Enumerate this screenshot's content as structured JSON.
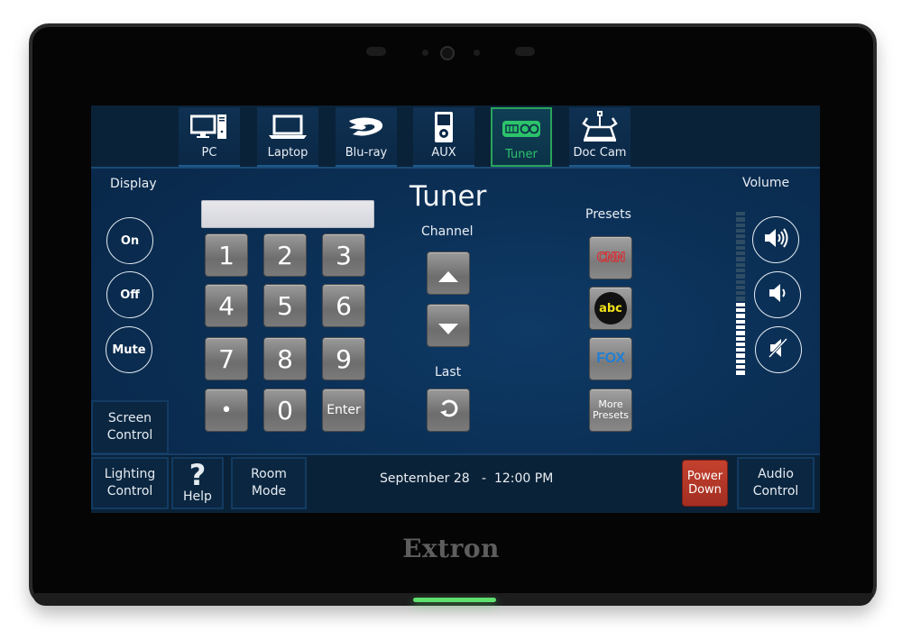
{
  "device": {
    "brand": "Extron"
  },
  "sources": [
    {
      "label": "PC",
      "icon": "pc-icon",
      "active": false
    },
    {
      "label": "Laptop",
      "icon": "laptop-icon",
      "active": false
    },
    {
      "label": "Blu-ray",
      "icon": "bluray-icon",
      "active": false
    },
    {
      "label": "AUX",
      "icon": "aux-player-icon",
      "active": false
    },
    {
      "label": "Tuner",
      "icon": "tuner-icon",
      "active": true
    },
    {
      "label": "Doc Cam",
      "icon": "document-camera-icon",
      "active": false
    }
  ],
  "display": {
    "label": "Display",
    "buttons": [
      "On",
      "Off",
      "Mute"
    ],
    "screen_control": [
      "Screen",
      "Control"
    ]
  },
  "keypad": {
    "entry_value": "",
    "keys": [
      "1",
      "2",
      "3",
      "4",
      "5",
      "6",
      "7",
      "8",
      "9",
      "•",
      "0",
      "Enter"
    ]
  },
  "tuner": {
    "title": "Tuner",
    "channel_label": "Channel",
    "last_label": "Last"
  },
  "presets": {
    "label": "Presets",
    "items": [
      {
        "name": "CNN",
        "icon": "cnn-logo"
      },
      {
        "name": "abc",
        "icon": "abc-logo"
      },
      {
        "name": "FOX",
        "icon": "fox-logo"
      },
      {
        "name": "More Presets",
        "lines": [
          "More",
          "Presets"
        ]
      }
    ]
  },
  "volume": {
    "label": "Volume",
    "level_percent": 45,
    "segments_total": 29,
    "segments_lit": 13,
    "buttons": [
      "volume-up",
      "volume-down",
      "volume-mute"
    ]
  },
  "bottom_bar": {
    "lighting_control": [
      "Lighting",
      "Control"
    ],
    "help": "Help",
    "room_mode": [
      "Room",
      "Mode"
    ],
    "date": "September 28",
    "time": "12:00 PM",
    "power_down": [
      "Power",
      "Down"
    ],
    "audio_control": [
      "Audio",
      "Control"
    ]
  },
  "colors": {
    "active_tab": "#2cc36b",
    "power_button": "#b5392a",
    "screen_bg": "#0b2f55",
    "status_led": "#5fe06f"
  }
}
